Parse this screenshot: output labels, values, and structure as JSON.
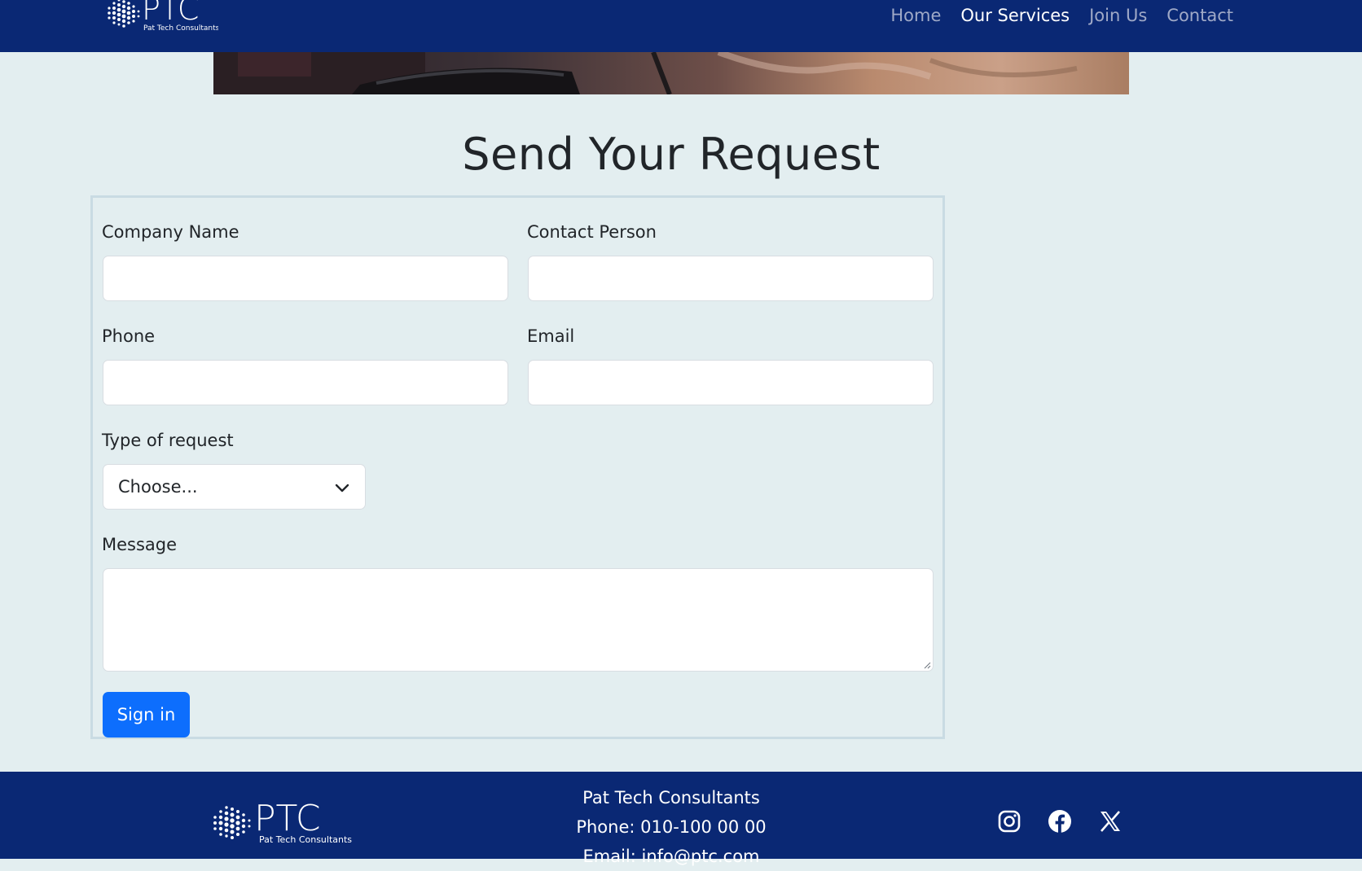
{
  "brand": {
    "name": "PTC",
    "tagline": "Pat Tech Consultants"
  },
  "nav": {
    "items": [
      {
        "label": "Home",
        "active": false
      },
      {
        "label": "Our Services",
        "active": true
      },
      {
        "label": "Join Us",
        "active": false
      },
      {
        "label": "Contact",
        "active": false
      }
    ]
  },
  "page": {
    "title": "Send Your Request"
  },
  "form": {
    "company_name": {
      "label": "Company Name",
      "value": ""
    },
    "contact_person": {
      "label": "Contact Person",
      "value": ""
    },
    "phone": {
      "label": "Phone",
      "value": ""
    },
    "email": {
      "label": "Email",
      "value": ""
    },
    "request_type": {
      "label": "Type of request",
      "selected": "Choose..."
    },
    "message": {
      "label": "Message",
      "value": ""
    },
    "submit_label": "Sign in"
  },
  "footer": {
    "company": "Pat Tech Consultants",
    "phone": "Phone: 010-100 00 00",
    "email": "Email: info@ptc.com",
    "socials": [
      "instagram-icon",
      "facebook-icon",
      "x-icon"
    ]
  },
  "colors": {
    "navy": "#0a2874",
    "page_bg": "#e3eef0",
    "primary_button": "#0d6efd"
  }
}
